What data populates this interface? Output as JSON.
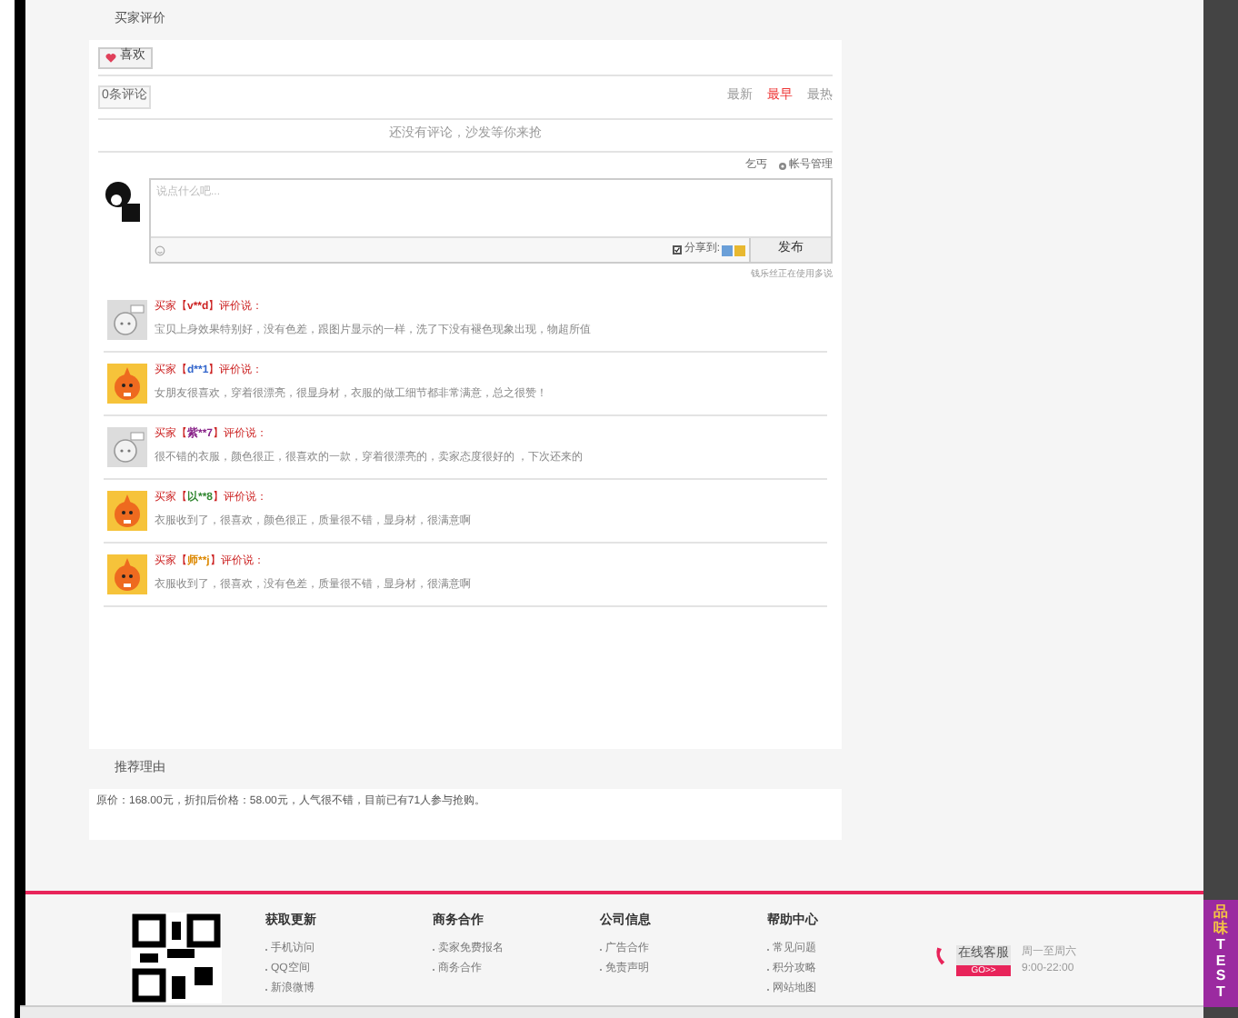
{
  "reviews_section": {
    "title": "买家评价",
    "like_button": {
      "label": "喜欢"
    },
    "comment_count": "0条评论",
    "sort_tabs": [
      {
        "label": "最新",
        "selected": false
      },
      {
        "label": "最早",
        "selected": true
      },
      {
        "label": "最热",
        "selected": false
      }
    ],
    "empty_message": "还没有评论，沙发等你来抢",
    "user_name": "乞丐",
    "account_link": "帐号管理",
    "comment_box": {
      "placeholder": "说点什么吧...",
      "share_label": "分享到:",
      "share_checked": true,
      "submit": "发布"
    },
    "powered_note": "钱乐丝正在使用多说"
  },
  "comments": [
    {
      "prefix": "买家【",
      "name": "v**d",
      "color": "#cc2222",
      "suffix": "】评价说：",
      "kind": "gray",
      "text": "宝贝上身效果特别好，没有色差，跟图片显示的一样，洗了下没有褪色现象出现，物超所值"
    },
    {
      "prefix": "买家【",
      "name": "d**1",
      "color": "#3366cc",
      "suffix": "】评价说：",
      "kind": "orange",
      "text": "女朋友很喜欢，穿着很漂亮，很显身材，衣服的做工细节都非常满意，总之很赞！"
    },
    {
      "prefix": "买家【",
      "name": "紫**7",
      "color": "#882288",
      "suffix": "】评价说：",
      "kind": "gray",
      "text": "很不错的衣服，颜色很正，很喜欢的一款，穿着很漂亮的，卖家态度很好的 ，下次还来的"
    },
    {
      "prefix": "买家【",
      "name": "以**8",
      "color": "#338833",
      "suffix": "】评价说：",
      "kind": "orange",
      "text": "衣服收到了，很喜欢，颜色很正，质量很不错，显身材，很满意啊"
    },
    {
      "prefix": "买家【",
      "name": "师**j",
      "color": "#dd8800",
      "suffix": "】评价说：",
      "kind": "orange",
      "text": "衣服收到了，很喜欢，没有色差，质量很不错，显身材，很满意啊"
    }
  ],
  "recommend": {
    "title": "推荐理由",
    "text": "原价：168.00元，折扣后价格：58.00元，人气很不错，目前已有71人参与抢购。"
  },
  "footer": {
    "columns": [
      {
        "title": "获取更新",
        "links": [
          "手机访问",
          "QQ空间",
          "新浪微博"
        ]
      },
      {
        "title": "商务合作",
        "links": [
          "卖家免费报名",
          "商务合作"
        ]
      },
      {
        "title": "公司信息",
        "links": [
          "广告合作",
          "免责声明"
        ]
      },
      {
        "title": "帮助中心",
        "links": [
          "常见问题",
          "积分攻略",
          "网站地图"
        ]
      }
    ],
    "service": {
      "label": "在线客服",
      "go": "GO>>",
      "days": "周一至周六",
      "hours": "9:00-22:00"
    }
  },
  "side_tab": {
    "chinese": "品味",
    "latin": "TEST"
  }
}
